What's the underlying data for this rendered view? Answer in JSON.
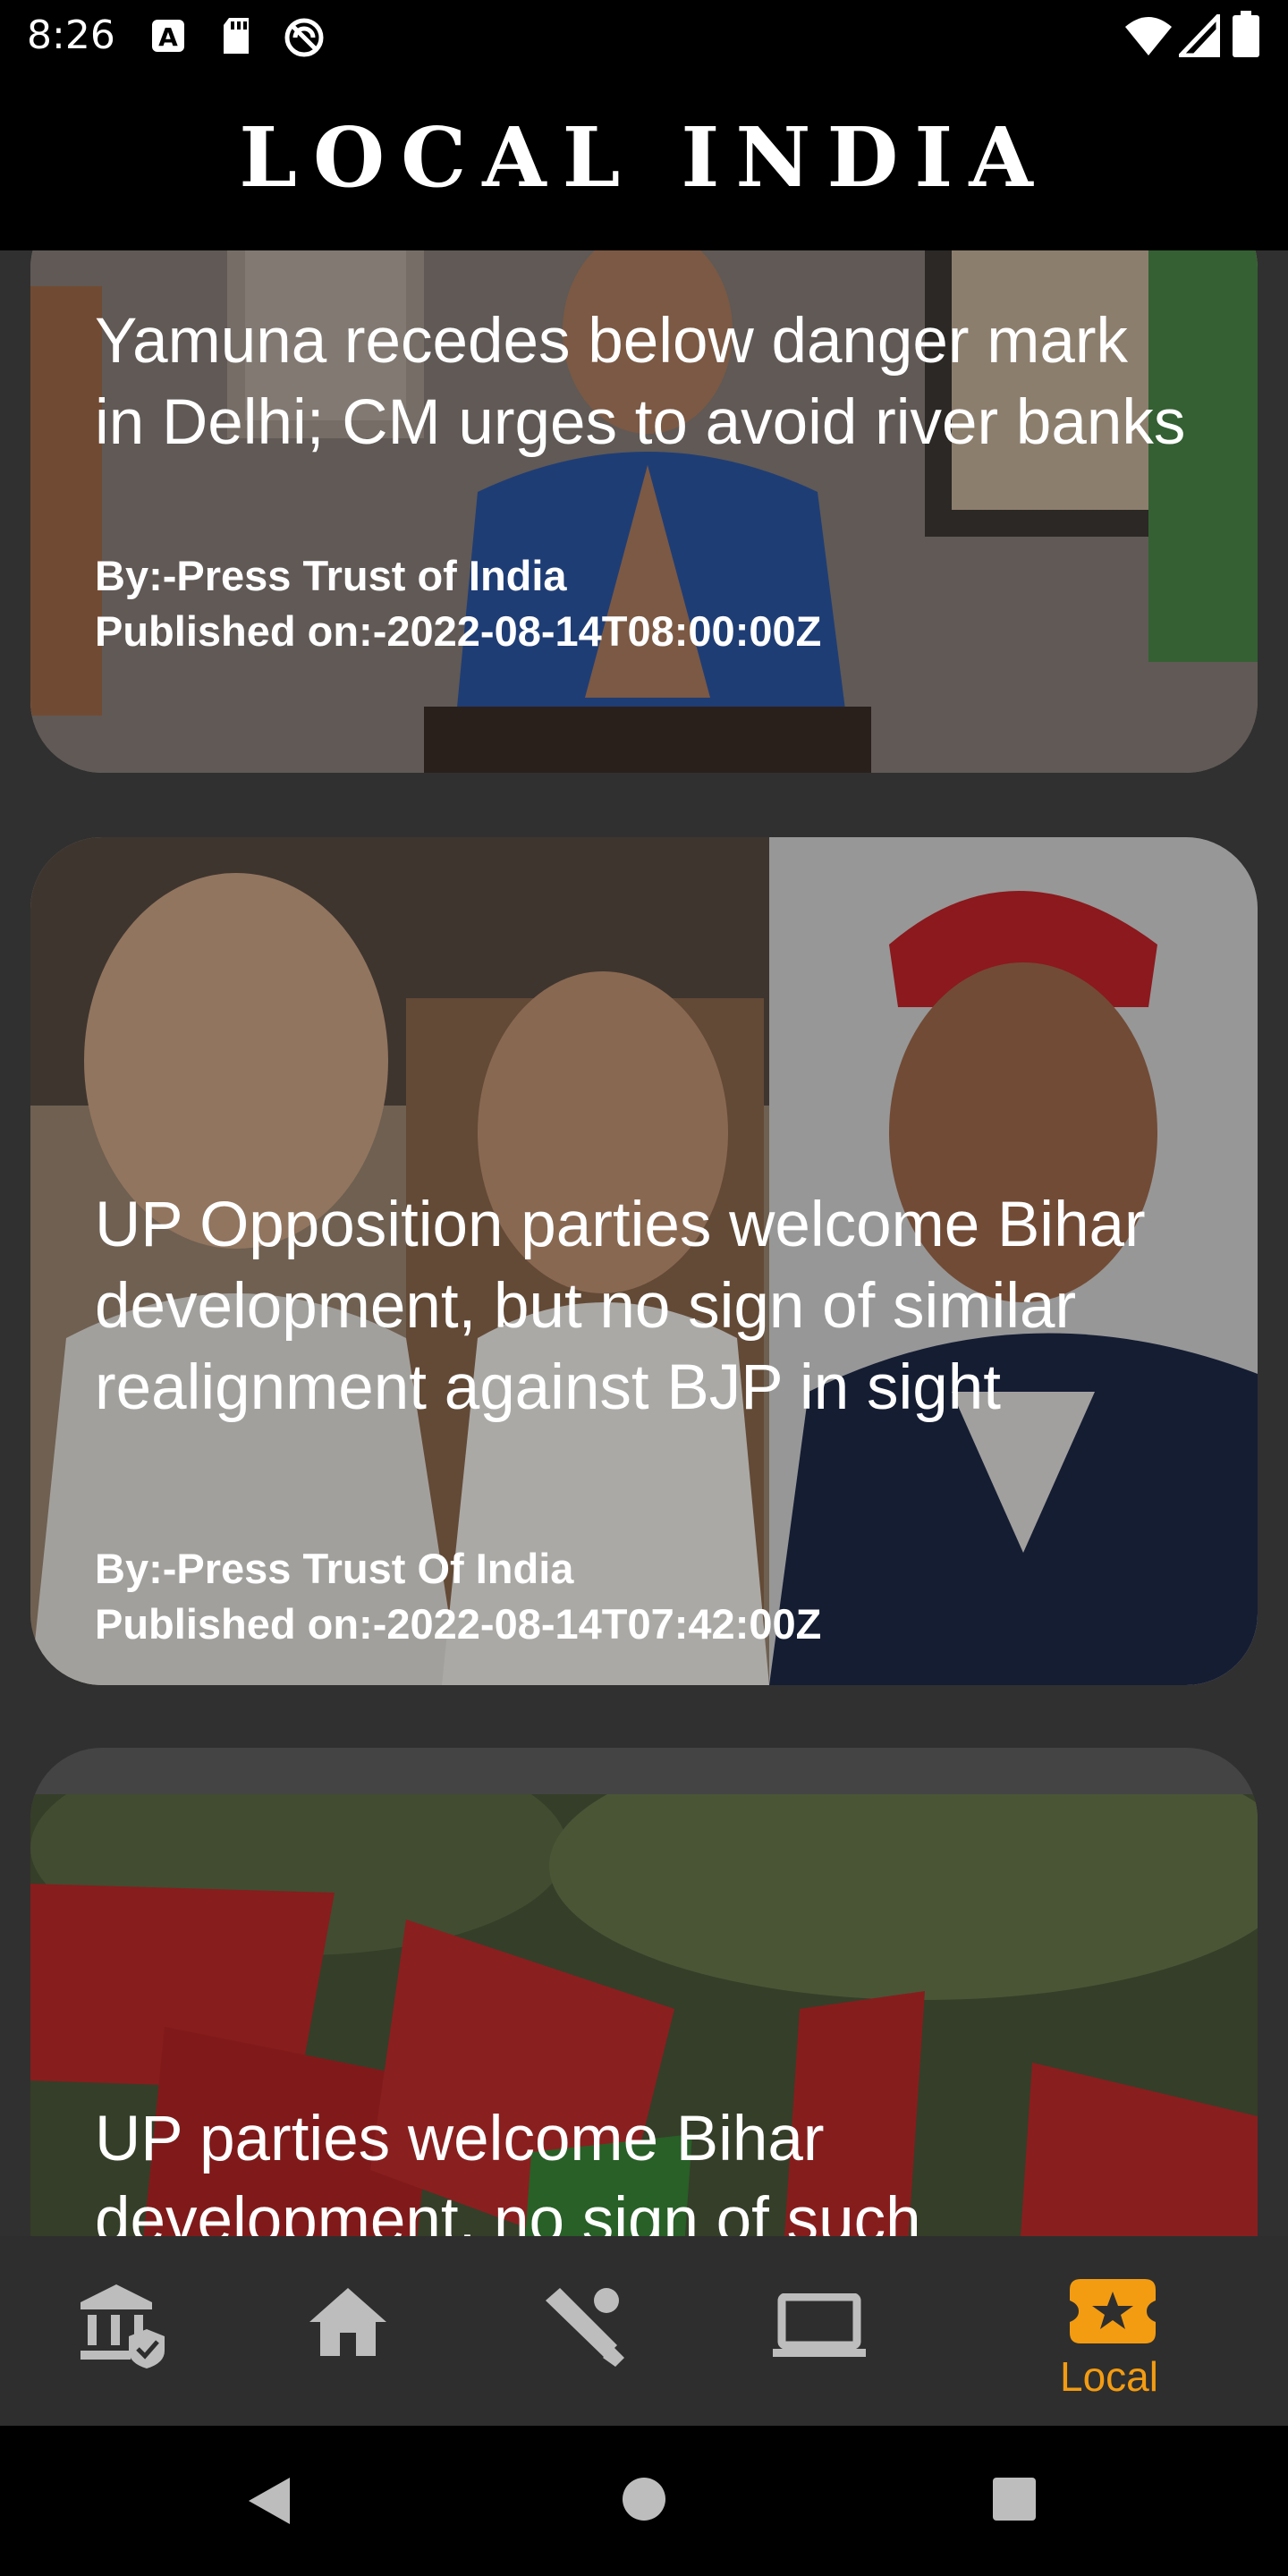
{
  "status_bar": {
    "time": "8:26",
    "icons": [
      "notification-a-icon",
      "sd-card-icon",
      "sync-off-icon",
      "wifi-icon",
      "signal-icon",
      "battery-icon"
    ]
  },
  "header": {
    "title": "LOCAL INDIA"
  },
  "articles": [
    {
      "title": "Yamuna recedes below danger mark in Delhi; CM urges to avoid river banks",
      "author": "By:-Press Trust of India",
      "published": "Published on:-2022-08-14T08:00:00Z"
    },
    {
      "title": "UP Opposition parties welcome Bihar development, but no sign of similar realignment against BJP in sight",
      "author": "By:-Press Trust Of India",
      "published": "Published on:-2022-08-14T07:42:00Z"
    },
    {
      "title": "UP parties welcome Bihar development, no sign of such",
      "author": "",
      "published": ""
    }
  ],
  "bottom_nav": {
    "items": [
      {
        "icon": "government-icon",
        "label": ""
      },
      {
        "icon": "home-icon",
        "label": ""
      },
      {
        "icon": "sports-cricket-icon",
        "label": ""
      },
      {
        "icon": "laptop-icon",
        "label": ""
      },
      {
        "icon": "local-star-icon",
        "label": "Local"
      }
    ],
    "active_index": 4,
    "active_color": "#f39c12",
    "inactive_color": "#bdbdbd"
  },
  "system_nav": [
    "back-icon",
    "home-circle-icon",
    "recents-icon"
  ]
}
